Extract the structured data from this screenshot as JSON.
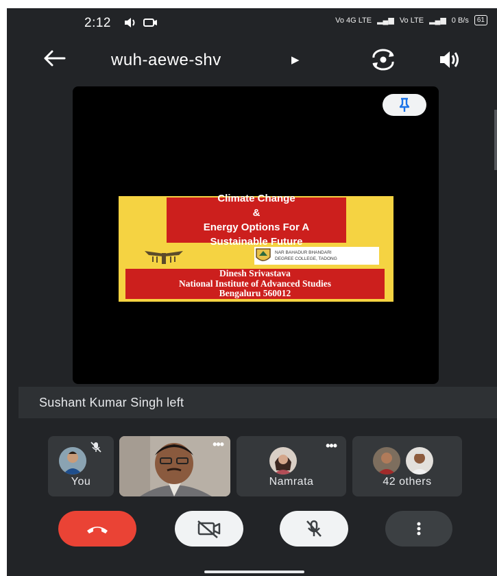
{
  "status_bar": {
    "time": "2:12",
    "network_left": "Vo 4G LTE",
    "network_right": "Vo LTE",
    "data_rate": "0 B/s",
    "battery": "61"
  },
  "header": {
    "meeting_code": "wuh-aewe-shv"
  },
  "slide": {
    "title_lines": [
      "Climate Change",
      "&",
      "Energy Options For A",
      "Sustainable Future"
    ],
    "college_lines": [
      "NAR BAHADUR BHANDARI",
      "DEGREE COLLEGE, TADONG"
    ],
    "speaker_lines": [
      "Dinesh Srivastava",
      "National Institute of Advanced Studies",
      "Bengaluru 560012"
    ]
  },
  "notification": {
    "text": "Sushant Kumar Singh left"
  },
  "participants": [
    {
      "label": "You"
    },
    {
      "label": ""
    },
    {
      "label": "Namrata"
    },
    {
      "label": "42 others"
    }
  ],
  "colors": {
    "background": "#222427",
    "end_call": "#ea4335",
    "accent": "#1a73e8",
    "slide_bg": "#f5d342",
    "slide_red": "#cc1f1d"
  }
}
